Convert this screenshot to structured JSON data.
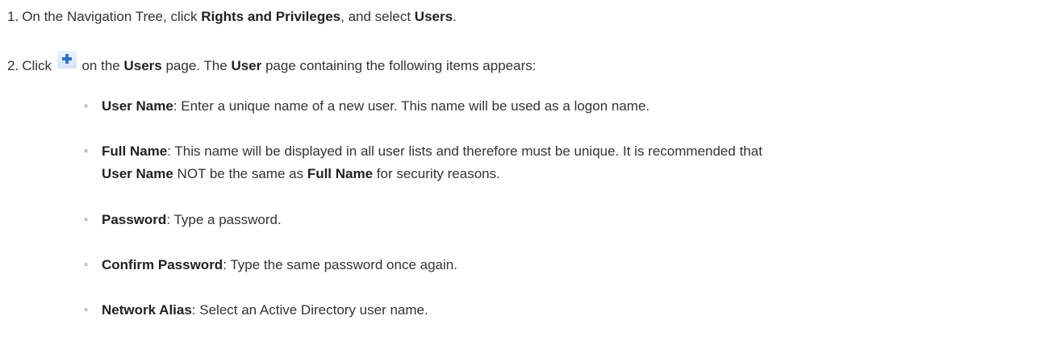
{
  "steps": [
    {
      "number": "1.",
      "t1": "On the Navigation Tree, click ",
      "b1": "Rights and Privileges",
      "t2": ", and select ",
      "b2": "Users",
      "t3": "."
    },
    {
      "number": "2.",
      "t1": "Click ",
      "icon": "plus-icon",
      "t2": " on the ",
      "b1": "Users",
      "t3": " page. The ",
      "b2": "User",
      "t4": " page containing the following items appears:"
    }
  ],
  "bullet_glyph": "◦",
  "items": [
    {
      "term": "User Name",
      "desc": ": Enter a unique name of a new user. This name will be used as a logon name."
    },
    {
      "term": "Full Name",
      "desc": ": This name will be displayed in all user lists and therefore must be unique. It is recommended that",
      "line2_b1": "User Name",
      "line2_t1": " NOT be the same as ",
      "line2_b2": "Full Name",
      "line2_t2": " for security reasons."
    },
    {
      "term": "Password",
      "desc": ": Type a password."
    },
    {
      "term": "Confirm Password",
      "desc": ": Type the same password once again."
    },
    {
      "term": "Network Alias",
      "desc": ": Select an Active Directory user name."
    }
  ],
  "colors": {
    "text": "#333333",
    "icon_accent": "#2f72c6"
  }
}
